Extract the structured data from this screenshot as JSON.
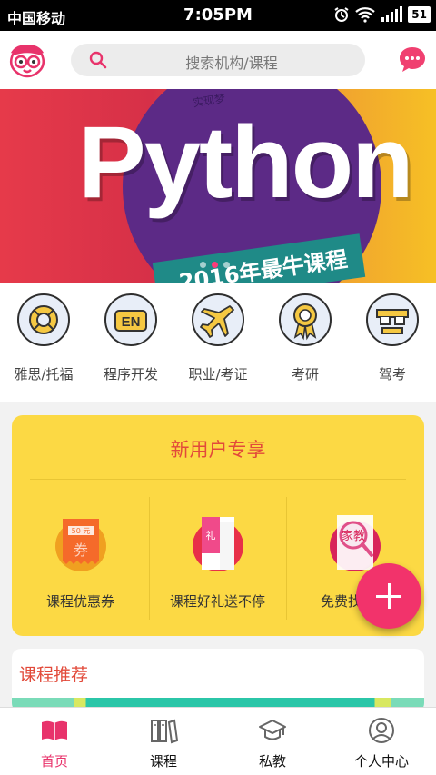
{
  "status_bar": {
    "carrier": "中国移动",
    "time": "7:05PM",
    "battery": "51",
    "icons": [
      "alarm-icon",
      "wifi-icon",
      "signal-icon",
      "battery-icon"
    ]
  },
  "header": {
    "logo": "owl-mascot-logo",
    "search_placeholder": "搜索机构/课程",
    "message_icon": "chat-bubble-icon"
  },
  "banner": {
    "headline": "Python",
    "slogan": "2016年最牛课程",
    "top_snippet": "实现梦",
    "slide_count": 3,
    "active_slide": 1
  },
  "categories": [
    {
      "label": "雅思/托福",
      "icon": "lifebuoy-icon"
    },
    {
      "label": "程序开发",
      "icon": "en-badge-icon"
    },
    {
      "label": "职业/考证",
      "icon": "airplane-icon"
    },
    {
      "label": "考研",
      "icon": "award-ribbon-icon"
    },
    {
      "label": "驾考",
      "icon": "steering-glasses-icon"
    }
  ],
  "new_user": {
    "title": "新用户专享",
    "perks": [
      {
        "label": "课程优惠券",
        "icon": "coupon-icon",
        "tag": "50 券"
      },
      {
        "label": "课程好礼送不停",
        "icon": "gift-icon",
        "tag": "礼品"
      },
      {
        "label": "免费找家教",
        "icon": "tutor-search-icon",
        "tag": "家教"
      }
    ]
  },
  "fab": {
    "icon": "plus-icon"
  },
  "recommend": {
    "title": "课程推荐"
  },
  "bottom_nav": [
    {
      "label": "首页",
      "icon": "book-open-icon",
      "active": true
    },
    {
      "label": "课程",
      "icon": "bookshelf-icon",
      "active": false
    },
    {
      "label": "私教",
      "icon": "graduation-cap-icon",
      "active": false
    },
    {
      "label": "个人中心",
      "icon": "user-profile-icon",
      "active": false
    }
  ],
  "colors": {
    "accent": "#e8336b",
    "card_yellow": "#fcd944",
    "title_red": "#e24a3a"
  }
}
